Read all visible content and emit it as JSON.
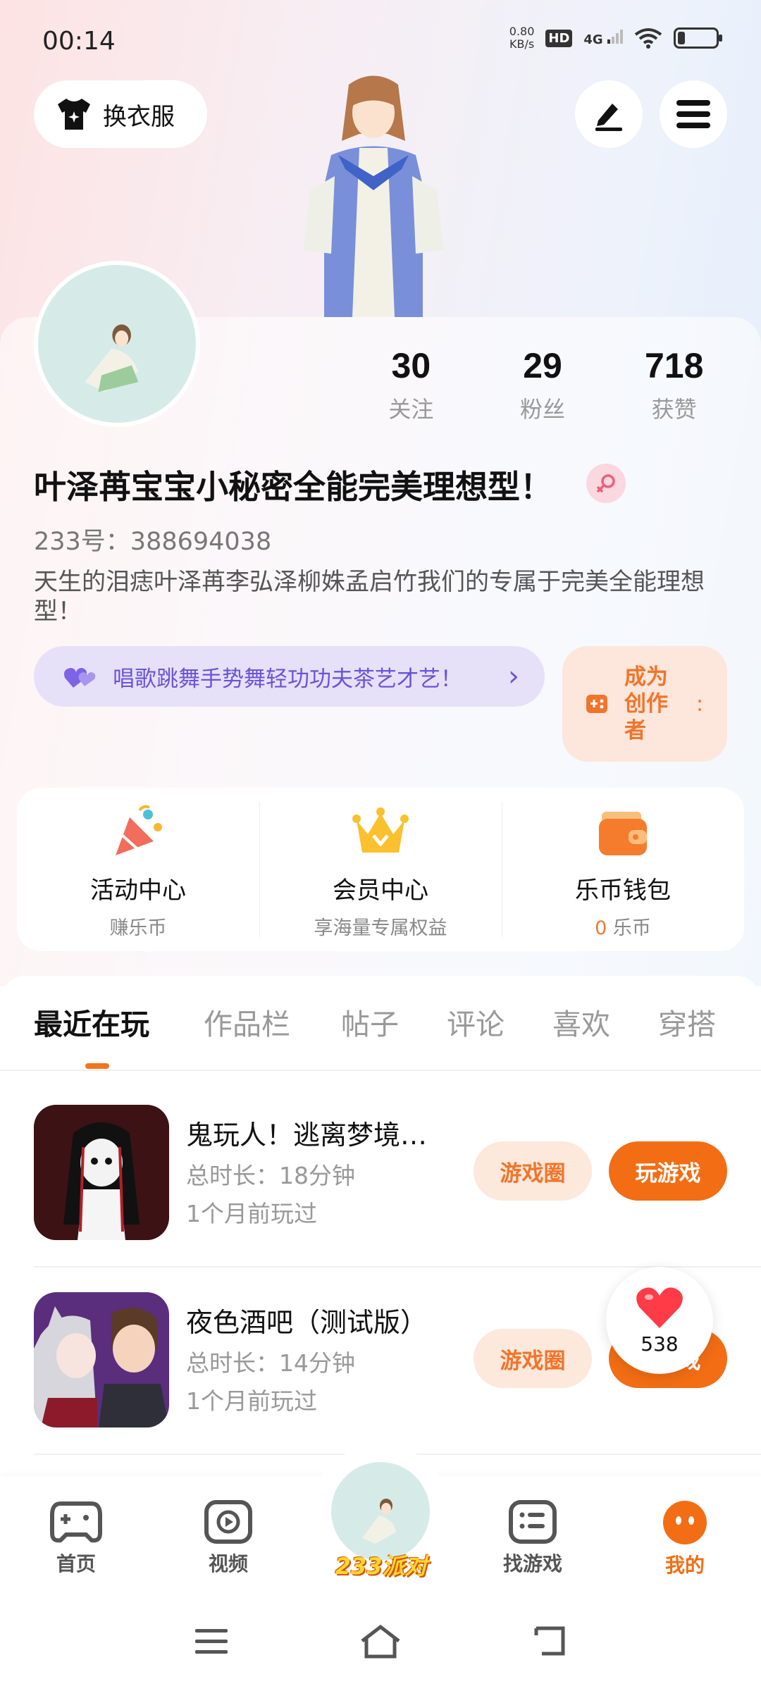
{
  "status_bar": {
    "time": "00:14",
    "net_speed_value": "0.80",
    "net_speed_unit": "KB/s",
    "hd": "HD",
    "network": "4G"
  },
  "header": {
    "outfit_label": "换衣服",
    "edit_icon": "pen-icon",
    "menu_icon": "hamburger-icon"
  },
  "profile": {
    "stats": [
      {
        "value": "30",
        "label": "关注"
      },
      {
        "value": "29",
        "label": "粉丝"
      },
      {
        "value": "718",
        "label": "获赞"
      }
    ],
    "username": "叶泽苒宝宝小秘密全能完美理想型！",
    "gender": "female",
    "user_id": "233号：388694038",
    "bio": "天生的泪痣叶泽苒李弘泽柳姝孟启竹我们的专属于完美全能理想型！",
    "tag_text": "唱歌跳舞手势舞轻功功夫茶艺才艺！",
    "creator_label": "成为创作者"
  },
  "services": [
    {
      "title": "活动中心",
      "sub": "赚乐币"
    },
    {
      "title": "会员中心",
      "sub": "享海量专属权益"
    },
    {
      "title": "乐币钱包",
      "sub_value": "0",
      "sub_unit": " 乐币"
    }
  ],
  "tabs": [
    {
      "label": "最近在玩",
      "active": true
    },
    {
      "label": "作品栏",
      "active": false
    },
    {
      "label": "帖子",
      "active": false
    },
    {
      "label": "评论",
      "active": false
    },
    {
      "label": "喜欢",
      "active": false
    },
    {
      "label": "穿搭",
      "active": false
    }
  ],
  "games": [
    {
      "title": "鬼玩人！逃离梦境…",
      "duration": "总时长：18分钟",
      "last_played": "1个月前玩过",
      "circle_label": "游戏圈",
      "play_label": "玩游戏"
    },
    {
      "title": "夜色酒吧（测试版）",
      "duration": "总时长：14分钟",
      "last_played": "1个月前玩过",
      "circle_label": "游戏圈",
      "play_label": "玩游戏"
    }
  ],
  "like_bubble": {
    "count": "538"
  },
  "bottom_nav": [
    {
      "label": "首页",
      "icon": "gamepad-icon"
    },
    {
      "label": "视频",
      "icon": "play-icon"
    },
    {
      "label": "233派对",
      "icon": "avatar"
    },
    {
      "label": "找游戏",
      "icon": "list-icon"
    },
    {
      "label": "我的",
      "icon": "face-icon",
      "active": true
    }
  ],
  "colors": {
    "accent": "#f26d14",
    "tag_purple": "#6a55d8",
    "background_pink": "#fde3e3",
    "background_blue": "#e3eefb"
  }
}
